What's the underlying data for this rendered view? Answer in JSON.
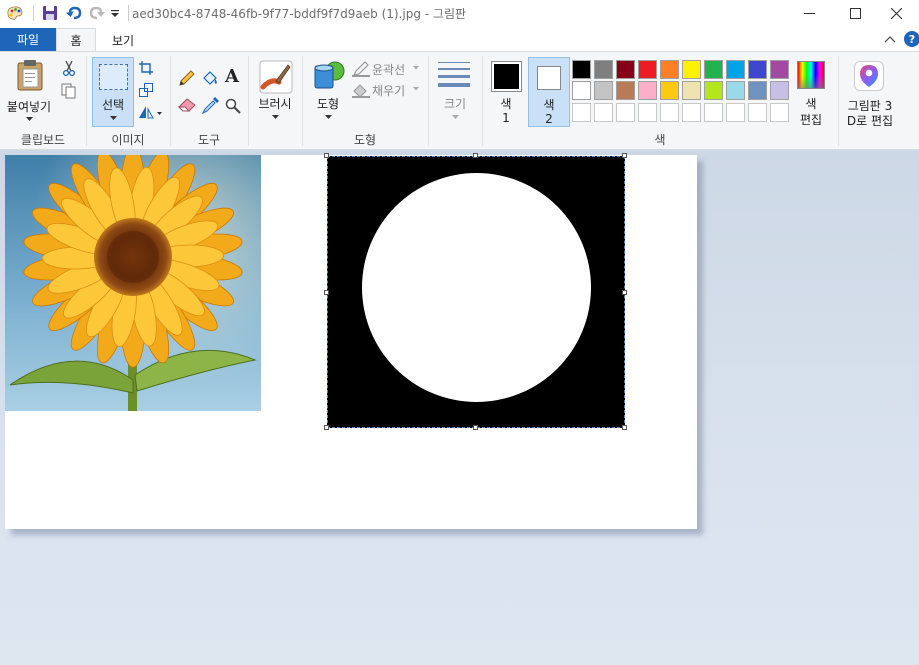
{
  "titlebar": {
    "title": "aed30bc4-8748-46fb-9f77-bddf9f7d9aeb (1).jpg - 그림판",
    "minimize_icon": "minimize-icon",
    "maximize_icon": "maximize-icon",
    "close_icon": "close-icon"
  },
  "tabs": {
    "file": "파일",
    "home": "홈",
    "view": "보기"
  },
  "ribbon": {
    "clipboard": {
      "paste": "붙여넣기",
      "group": "클립보드"
    },
    "image": {
      "select": "선택",
      "group": "이미지"
    },
    "tools": {
      "group": "도구"
    },
    "brushes": {
      "label": "브러시"
    },
    "shapes": {
      "shapes": "도형",
      "outline": "윤곽선",
      "fill": "채우기",
      "group": "도형"
    },
    "size": {
      "label": "크기"
    },
    "colors": {
      "color1_a": "색",
      "color1_b": "1",
      "color2_a": "색",
      "color2_b": "2",
      "edit_a": "색",
      "edit_b": "편집",
      "group": "색",
      "color1": "#000000",
      "color2": "#ffffff",
      "palette_row1": [
        "#000000",
        "#7f7f7f",
        "#880015",
        "#ed1c24",
        "#ff7f27",
        "#fff200",
        "#22b14c",
        "#00a2e8",
        "#3f48cc",
        "#a349a4"
      ],
      "palette_row2": [
        "#ffffff",
        "#c3c3c3",
        "#b97a57",
        "#ffaec9",
        "#ffc90e",
        "#efe4b0",
        "#b5e61d",
        "#99d9ea",
        "#7092be",
        "#c8bfe7"
      ]
    },
    "paint3d": {
      "line1": "그림판 3",
      "line2": "D로 편집"
    }
  },
  "canvas": {
    "background": "#ffffff",
    "selection_fill": "#000000",
    "circle_fill": "#ffffff"
  }
}
